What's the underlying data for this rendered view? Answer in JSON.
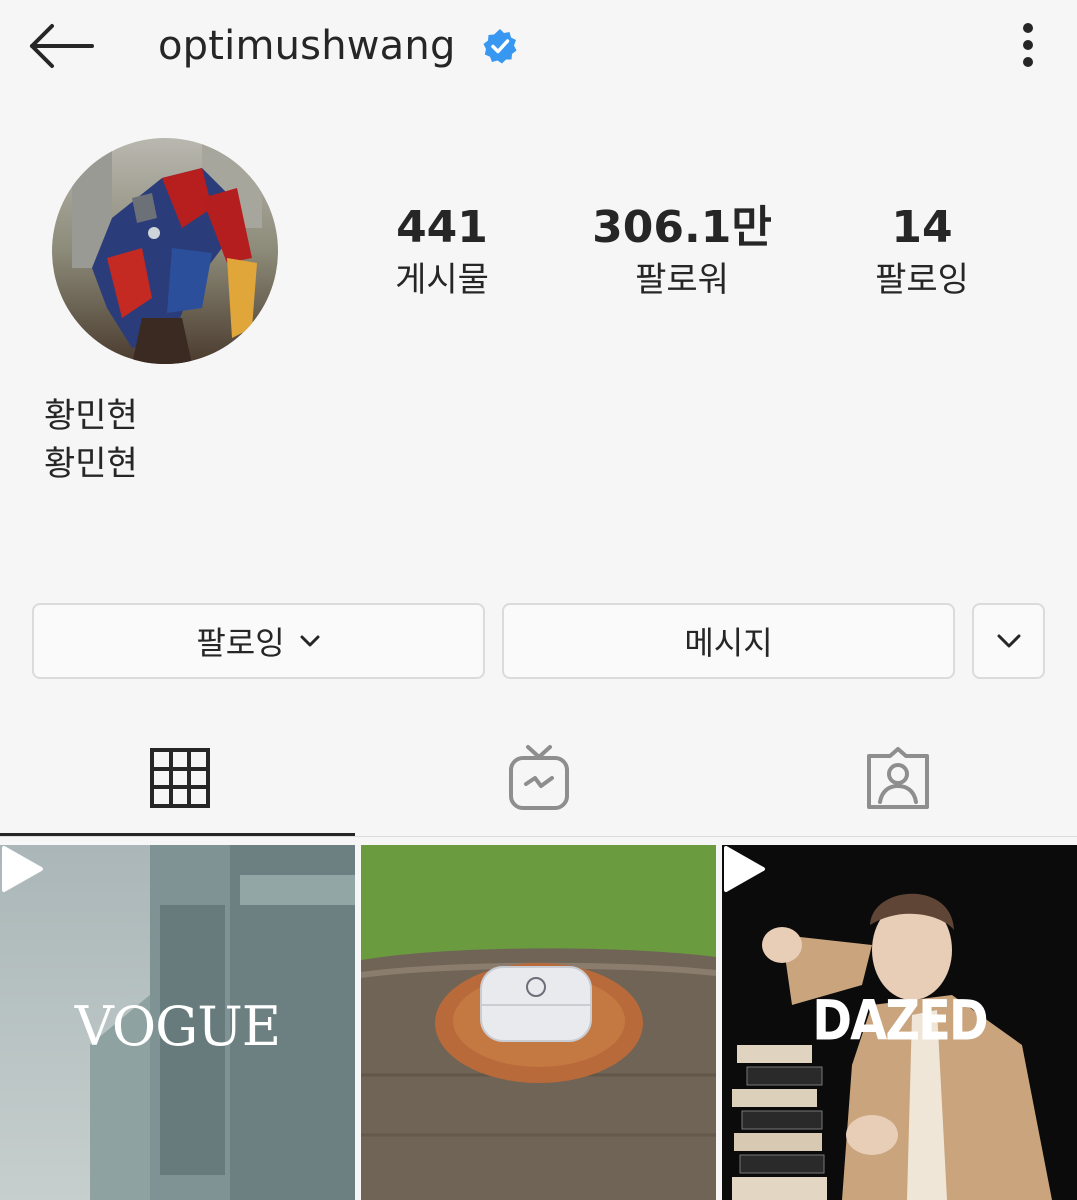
{
  "header": {
    "back_icon": "arrow-left-icon",
    "username": "optimushwang",
    "verified_icon": "verified-badge-icon",
    "verified_color": "#3897f0",
    "more_icon": "more-vertical-icon"
  },
  "profile": {
    "avatar": "avatar-image",
    "name": "황민현",
    "bio": "황민현"
  },
  "stats": {
    "posts": {
      "value": "441",
      "label": "게시물"
    },
    "followers": {
      "value": "306.1만",
      "label": "팔로워"
    },
    "following": {
      "value": "14",
      "label": "팔로잉"
    }
  },
  "actions": {
    "following_label": "팔로잉",
    "message_label": "메시지",
    "suggest_icon": "chevron-down-icon"
  },
  "tabs": [
    {
      "icon": "grid-icon",
      "active": true
    },
    {
      "icon": "igtv-icon",
      "active": false
    },
    {
      "icon": "tagged-icon",
      "active": false
    }
  ],
  "posts": [
    {
      "overlay_text": "VOGUE",
      "type": "video"
    },
    {
      "overlay_text": "",
      "type": "image"
    },
    {
      "overlay_text": "DAZED",
      "type": "video"
    }
  ]
}
